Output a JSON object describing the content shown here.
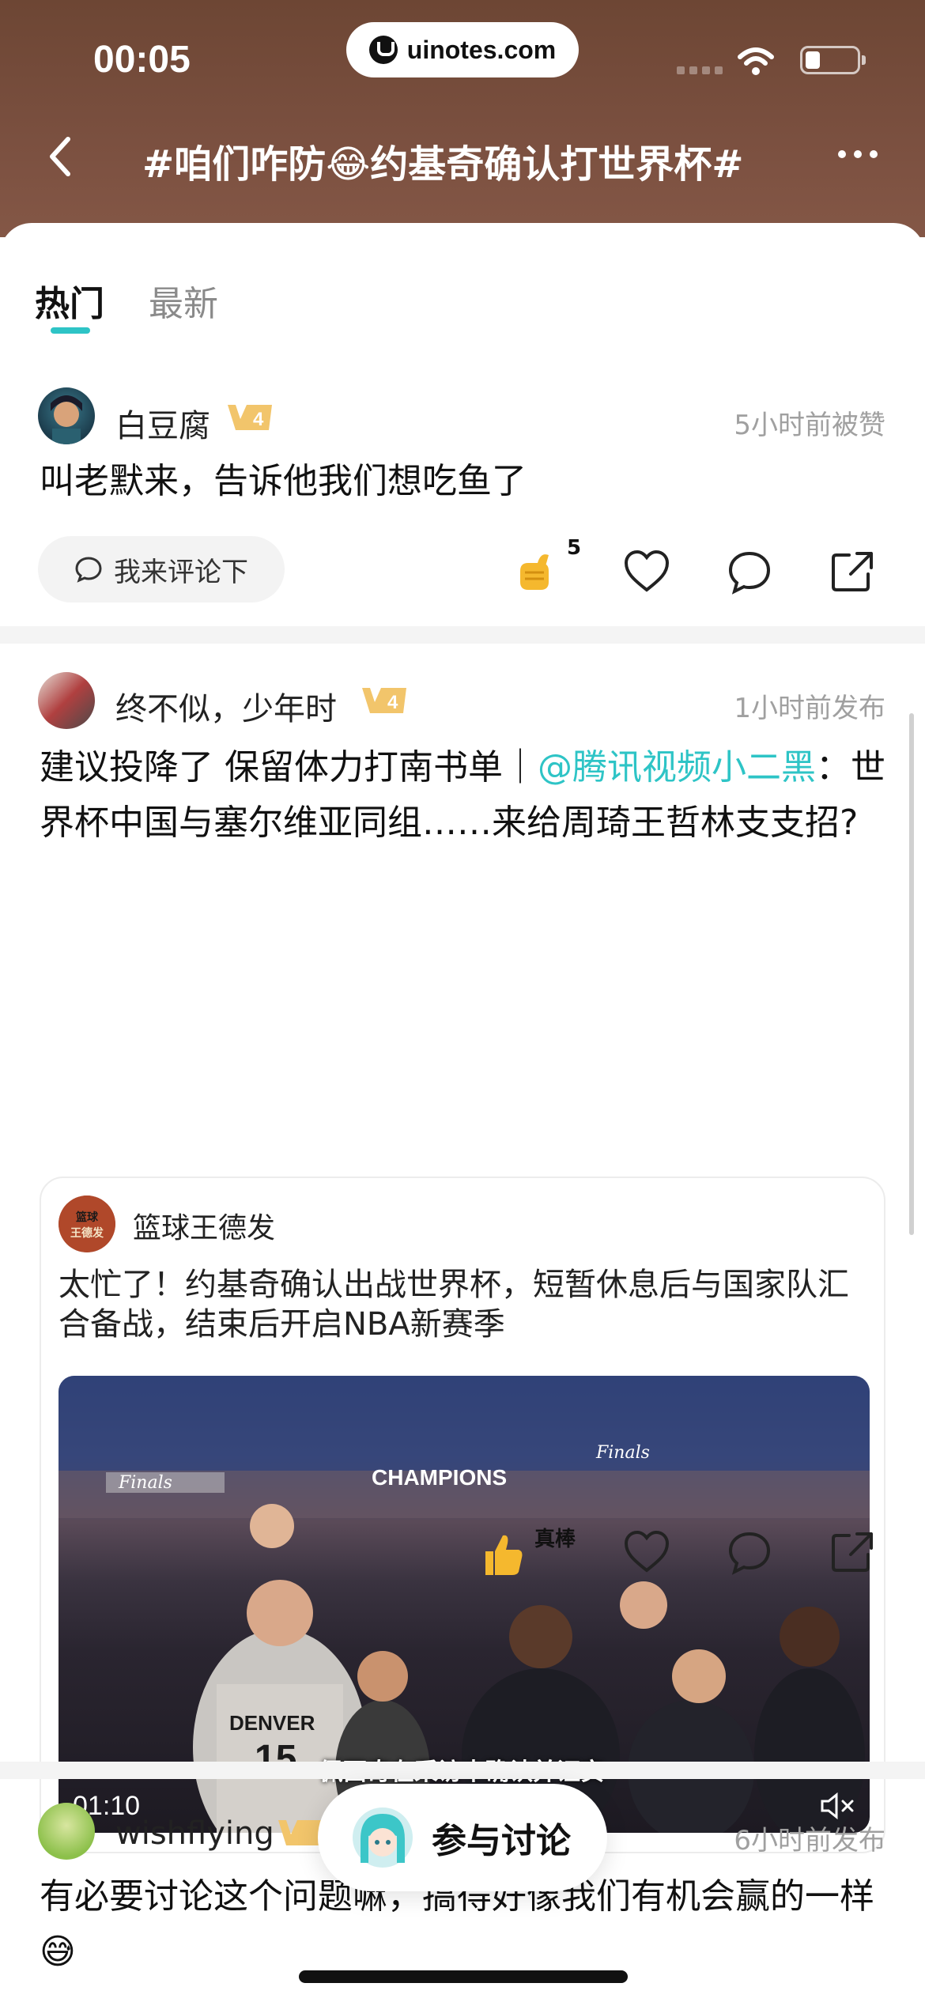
{
  "status_bar": {
    "time": "00:05",
    "url": "uinotes.com"
  },
  "header": {
    "title": "#咱们咋防😂约基奇确认打世界杯#"
  },
  "tabs": [
    {
      "label": "热门"
    },
    {
      "label": "最新"
    }
  ],
  "posts": [
    {
      "author": "白豆腐",
      "level": "4",
      "time": "5小时前被赞",
      "text": "叫老默来，告诉他我们想吃鱼了",
      "comment_prompt": "我来评论下",
      "reaction_count": "5"
    },
    {
      "author": "终不似，少年时",
      "level": "4",
      "time": "1小时前发布",
      "text_before": "建议投降了 保留体力打南书单｜",
      "mention": "@腾讯视频小二黑",
      "text_after": "：世界杯中国与塞尔维亚同组……来给周琦王哲林支支招?",
      "quote": {
        "source": "篮球王德发",
        "source_logo_text": "篮球王德发",
        "text": "太忙了！约基奇确认出战世界杯，短暂休息后与国家队汇合备战，结束后开启NBA新赛季",
        "video_duration": "01:10",
        "video_caption": "佩西奇在采访中确认并证实",
        "video_texts": [
          "Finals",
          "CHAMPIONS",
          "DENVER",
          "15"
        ]
      },
      "reaction_label": "真棒"
    },
    {
      "author": "wishflying",
      "time": "6小时前发布",
      "text": "有必要讨论这个问题嘛，搞得好像我们有机会赢的一样😅"
    }
  ],
  "join_button": {
    "label": "参与讨论"
  },
  "colors": {
    "accent": "#2ec4c6",
    "header_bg": "#7b5040"
  }
}
